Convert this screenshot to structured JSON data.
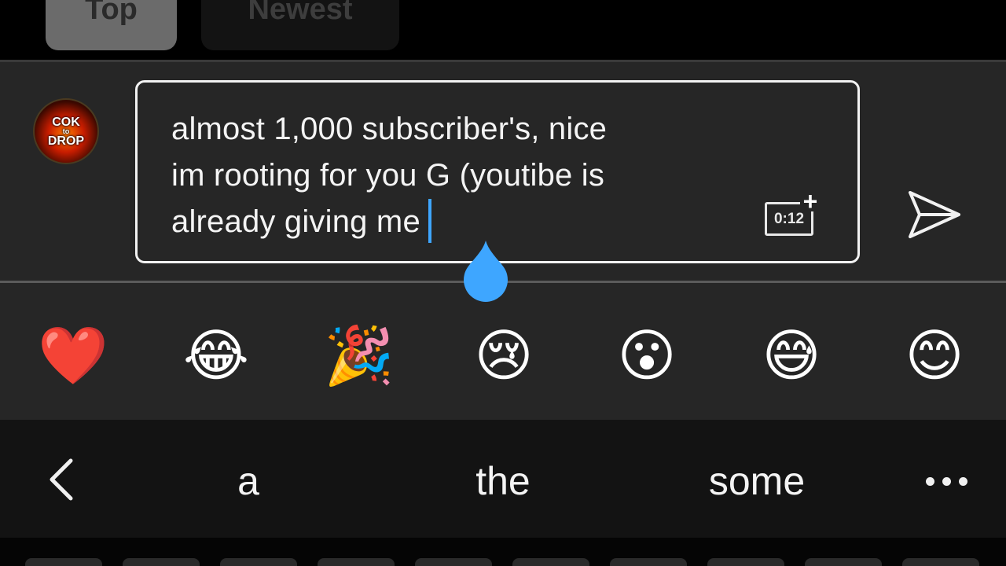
{
  "sort_tabs": {
    "top_label": "Top",
    "newest_label": "Newest",
    "selected": "Top"
  },
  "composer": {
    "avatar_text": [
      "COK",
      "to",
      "DROP"
    ],
    "comment_lines": [
      "almost 1,000 subscriber's, nice",
      "im rooting for you G (youtibe is",
      "already giving me"
    ],
    "timestamp_label": "0:12",
    "send_icon": "send-icon",
    "caret_color": "#3ea6ff"
  },
  "emoji_bar": {
    "items": [
      {
        "name": "red-heart",
        "char": "❤️"
      },
      {
        "name": "tears-of-joy",
        "char": "😂"
      },
      {
        "name": "party-popper",
        "char": "🎉"
      },
      {
        "name": "crying-face",
        "char": "😢"
      },
      {
        "name": "hushed-face",
        "char": "😮"
      },
      {
        "name": "grinning-sweat",
        "char": "😅"
      },
      {
        "name": "smiling-face",
        "char": "😊"
      }
    ]
  },
  "suggestions": {
    "words": [
      "a",
      "the",
      "some"
    ],
    "back_icon": "chevron-left-icon",
    "more_icon": "more-horizontal-icon"
  },
  "colors": {
    "accent": "#3ea6ff",
    "panel": "#262626",
    "background": "#000000"
  }
}
